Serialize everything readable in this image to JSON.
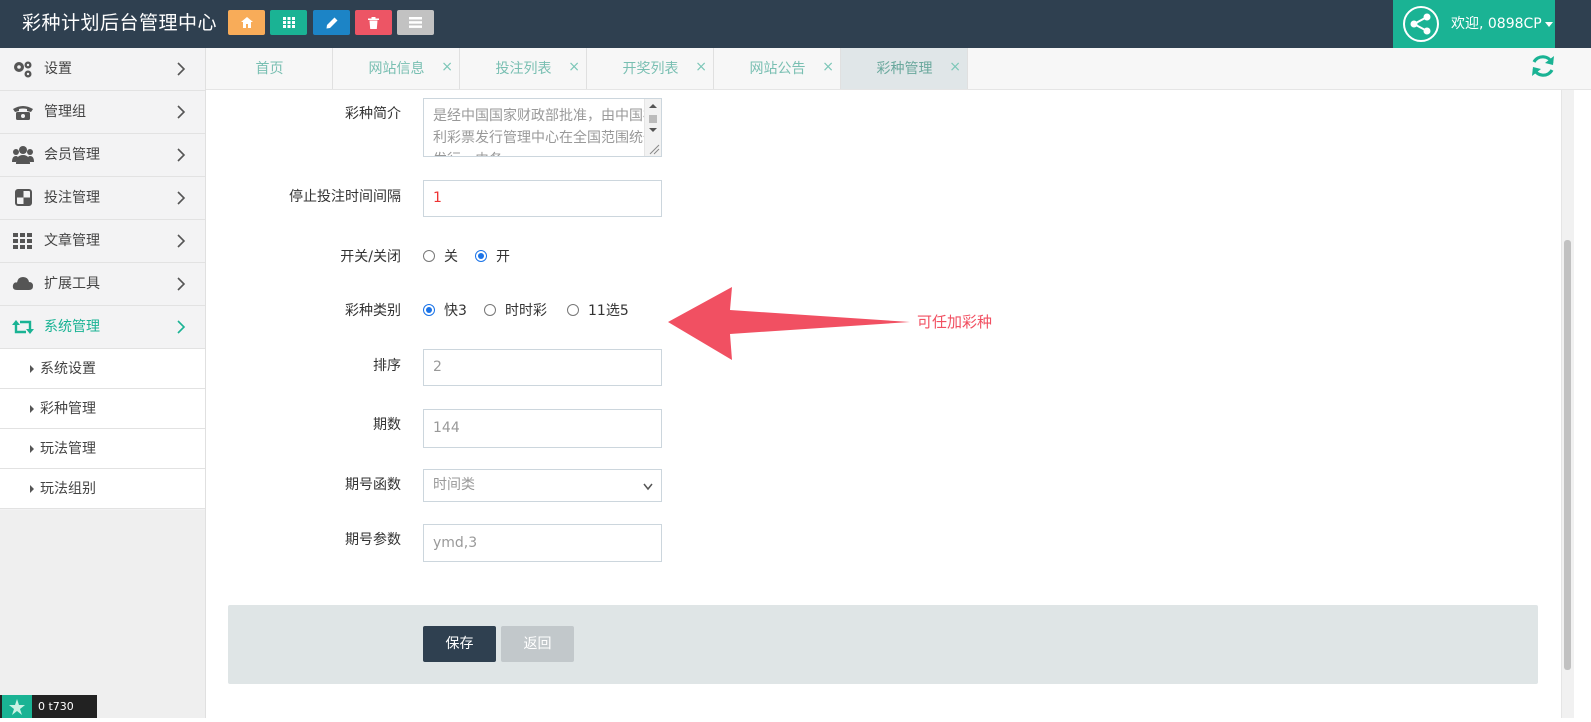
{
  "header": {
    "brand": "彩种计划后台管理中心",
    "toolbar_colors": [
      "#f8ac59",
      "#1ab394",
      "#1c84c6",
      "#ed5565",
      "#c2c2c2"
    ],
    "user": {
      "greeting": "欢迎, 0898CP"
    }
  },
  "sidebar": {
    "items": [
      {
        "label": "设置",
        "icon": "gears-icon"
      },
      {
        "label": "管理组",
        "icon": "phone-icon"
      },
      {
        "label": "会员管理",
        "icon": "users-icon"
      },
      {
        "label": "投注管理",
        "icon": "checker-icon"
      },
      {
        "label": "文章管理",
        "icon": "grid-icon"
      },
      {
        "label": "扩展工具",
        "icon": "cloud-icon"
      },
      {
        "label": "系统管理",
        "icon": "retweet-icon",
        "active": true
      }
    ],
    "sub_items": [
      "系统设置",
      "彩种管理",
      "玩法管理",
      "玩法组别"
    ],
    "mini_badge": "0  t730"
  },
  "tabs": [
    {
      "label": "首页",
      "closable": false
    },
    {
      "label": "网站信息",
      "closable": true
    },
    {
      "label": "投注列表",
      "closable": true
    },
    {
      "label": "开奖列表",
      "closable": true
    },
    {
      "label": "网站公告",
      "closable": true
    },
    {
      "label": "彩种管理",
      "closable": true,
      "active": true
    }
  ],
  "tab_close_glyph": "×",
  "form": {
    "intro": {
      "label": "彩种简介",
      "value": "是经中国国家财政部批准，由中国福利彩票发行管理中心在全国范围统一发行，由各..."
    },
    "stop_interval": {
      "label": "停止投注时间间隔",
      "value": "1"
    },
    "switch": {
      "label": "开关/关闭",
      "options": [
        "关",
        "开"
      ],
      "selected": "开"
    },
    "category": {
      "label": "彩种类别",
      "options": [
        "快3",
        "时时彩",
        "11选5"
      ],
      "selected": "快3"
    },
    "sort": {
      "label": "排序",
      "value": "2"
    },
    "issues": {
      "label": "期数",
      "value": "144"
    },
    "issue_func": {
      "label": "期号函数",
      "value": "时间类"
    },
    "issue_param": {
      "label": "期号参数",
      "value": "ymd,3"
    }
  },
  "buttons": {
    "save": "保存",
    "back": "返回"
  },
  "annotation": {
    "text": "可任加彩种",
    "color": "#f15062"
  }
}
